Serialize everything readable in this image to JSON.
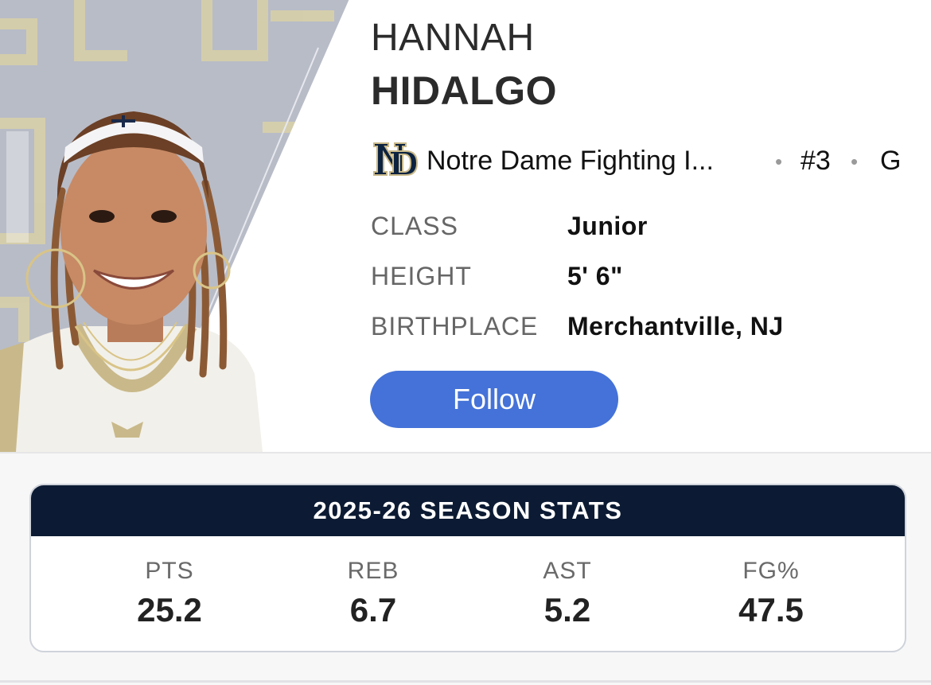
{
  "player": {
    "first_name": "HANNAH",
    "last_name": "HIDALGO",
    "photo_icon": "player-headshot"
  },
  "team": {
    "name": "Notre Dame Fighting I...",
    "logo_icon": "notre-dame-nd-logo",
    "jersey": "#3",
    "position": "G",
    "separator": "•"
  },
  "info": [
    {
      "label": "CLASS",
      "value": "Junior"
    },
    {
      "label": "HEIGHT",
      "value": "5' 6\""
    },
    {
      "label": "BIRTHPLACE",
      "value": "Merchantville, NJ"
    }
  ],
  "follow_button": {
    "label": "Follow"
  },
  "season_stats": {
    "title": "2025-26 SEASON STATS",
    "stats": [
      {
        "label": "PTS",
        "value": "25.2"
      },
      {
        "label": "REB",
        "value": "6.7"
      },
      {
        "label": "AST",
        "value": "5.2"
      },
      {
        "label": "FG%",
        "value": "47.5"
      }
    ]
  },
  "colors": {
    "follow_button": "#4472d8",
    "stats_header": "#0c1b33",
    "notre_dame_gold": "#c9b98a",
    "notre_dame_navy": "#0c2340"
  }
}
